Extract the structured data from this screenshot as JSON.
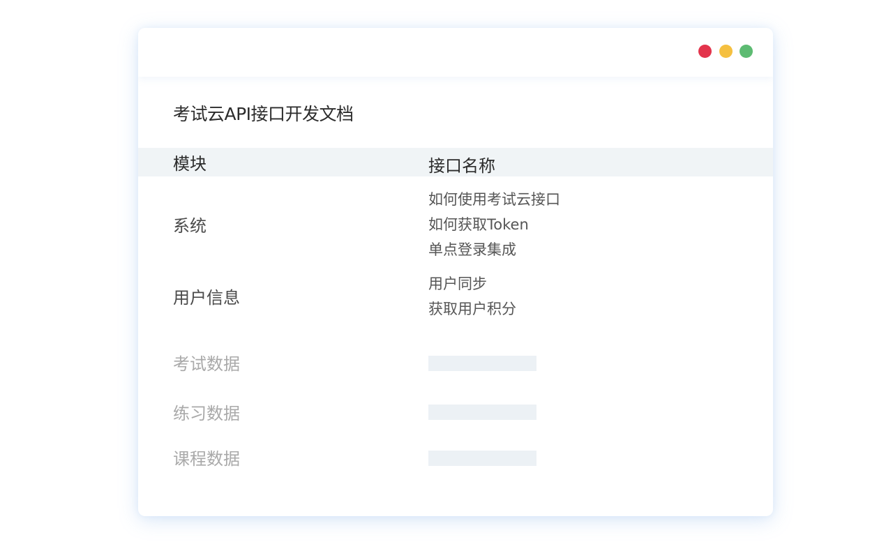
{
  "window": {
    "controls": [
      {
        "name": "close",
        "color": "#e3344c"
      },
      {
        "name": "minimize",
        "color": "#f5c040"
      },
      {
        "name": "maximize",
        "color": "#5dbb72"
      }
    ]
  },
  "document": {
    "title": "考试云API接口开发文档",
    "columns": {
      "module": "模块",
      "api_name": "接口名称"
    },
    "rows": [
      {
        "module": "系统",
        "apis": [
          "如何使用考试云接口",
          "如何获取Token",
          "单点登录集成"
        ]
      },
      {
        "module": "用户信息",
        "apis": [
          "用户同步",
          "获取用户积分"
        ]
      },
      {
        "module": "考试数据",
        "apis": []
      },
      {
        "module": "练习数据",
        "apis": []
      },
      {
        "module": "课程数据",
        "apis": []
      }
    ]
  }
}
